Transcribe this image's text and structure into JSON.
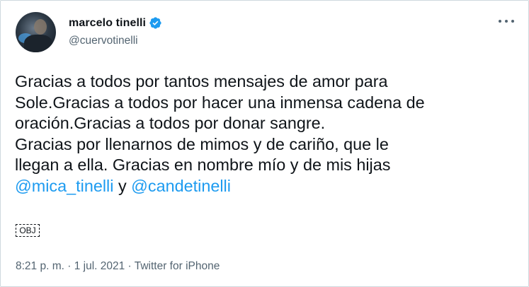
{
  "author": {
    "display_name": "marcelo tinelli",
    "handle": "@cuervotinelli",
    "verified": true
  },
  "tweet": {
    "line1": "Gracias a todos por tantos mensajes de amor para",
    "line2": "Sole.Gracias a todos por hacer una inmensa cadena de",
    "line3": "oración.Gracias a todos por donar sangre.",
    "line4": "Gracias por llenarnos de mimos y de cariño, que le",
    "line5": "llegan a ella. Gracias en nombre mío y de mis hijas",
    "mention1": "@mica_tinelli",
    "connector": " y ",
    "mention2": "@candetinelli",
    "emoji_placeholder": "OBJ"
  },
  "meta": {
    "text": "8:21 p. m. · 1 jul. 2021 · Twitter for iPhone"
  },
  "icons": {
    "verified": "verified-badge-icon",
    "more": "more-options-icon"
  },
  "colors": {
    "link": "#1d9bf0",
    "secondary_text": "#536471",
    "verified": "#1d9bf0"
  }
}
